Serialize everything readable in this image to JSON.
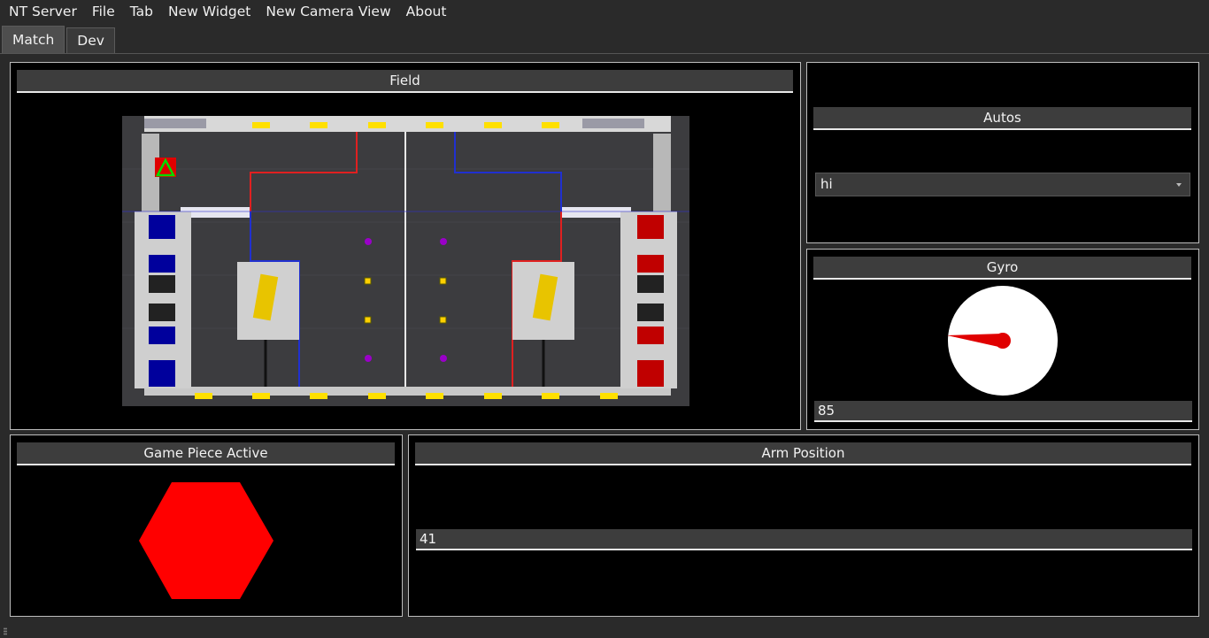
{
  "menu": {
    "items": [
      "NT Server",
      "File",
      "Tab",
      "New Widget",
      "New Camera View",
      "About"
    ]
  },
  "tabs": [
    {
      "label": "Match",
      "active": true
    },
    {
      "label": "Dev",
      "active": false
    }
  ],
  "widgets": {
    "field": {
      "title": "Field"
    },
    "autos": {
      "title": "Autos",
      "selected": "hi"
    },
    "gyro": {
      "title": "Gyro",
      "value": "85"
    },
    "game_piece": {
      "title": "Game Piece Active",
      "color": "#ff0000",
      "shape": "hexagon"
    },
    "arm": {
      "title": "Arm Position",
      "value": "41"
    }
  },
  "colors": {
    "red_alliance": "#e00000",
    "blue_alliance": "#00009c",
    "robot_marker": "#00dd00",
    "background": "#000000",
    "panel_border": "#bdbdbd"
  }
}
